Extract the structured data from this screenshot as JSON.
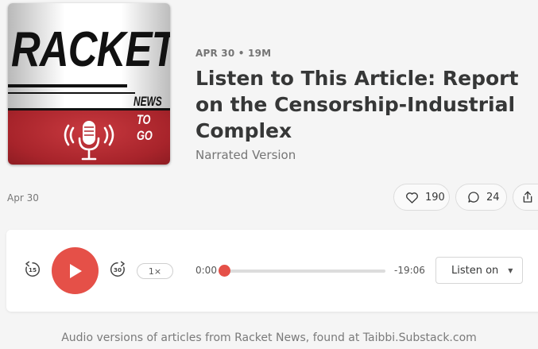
{
  "cover": {
    "title": "RACKET",
    "news": "NEWS",
    "togo": "TO GO"
  },
  "post": {
    "meta": "APR 30 • 19M",
    "title": "Listen to This Article: Report on the Censorship-Industrial Complex",
    "subtitle": "Narrated Version",
    "date": "Apr 30"
  },
  "actions": {
    "likes": "190",
    "comments": "24",
    "like_icon": "heart-icon",
    "comment_icon": "comment-icon",
    "share_icon": "share-icon"
  },
  "player": {
    "rewind_label": "15",
    "forward_label": "30",
    "speed": "1×",
    "current_time": "0:00",
    "remaining_time": "-19:06",
    "progress_fraction": 0.02,
    "listen_on": "Listen on",
    "accent_color": "#e55048"
  },
  "footer": {
    "text": "Audio versions of articles from Racket News, found at Taibbi.Substack.com"
  }
}
